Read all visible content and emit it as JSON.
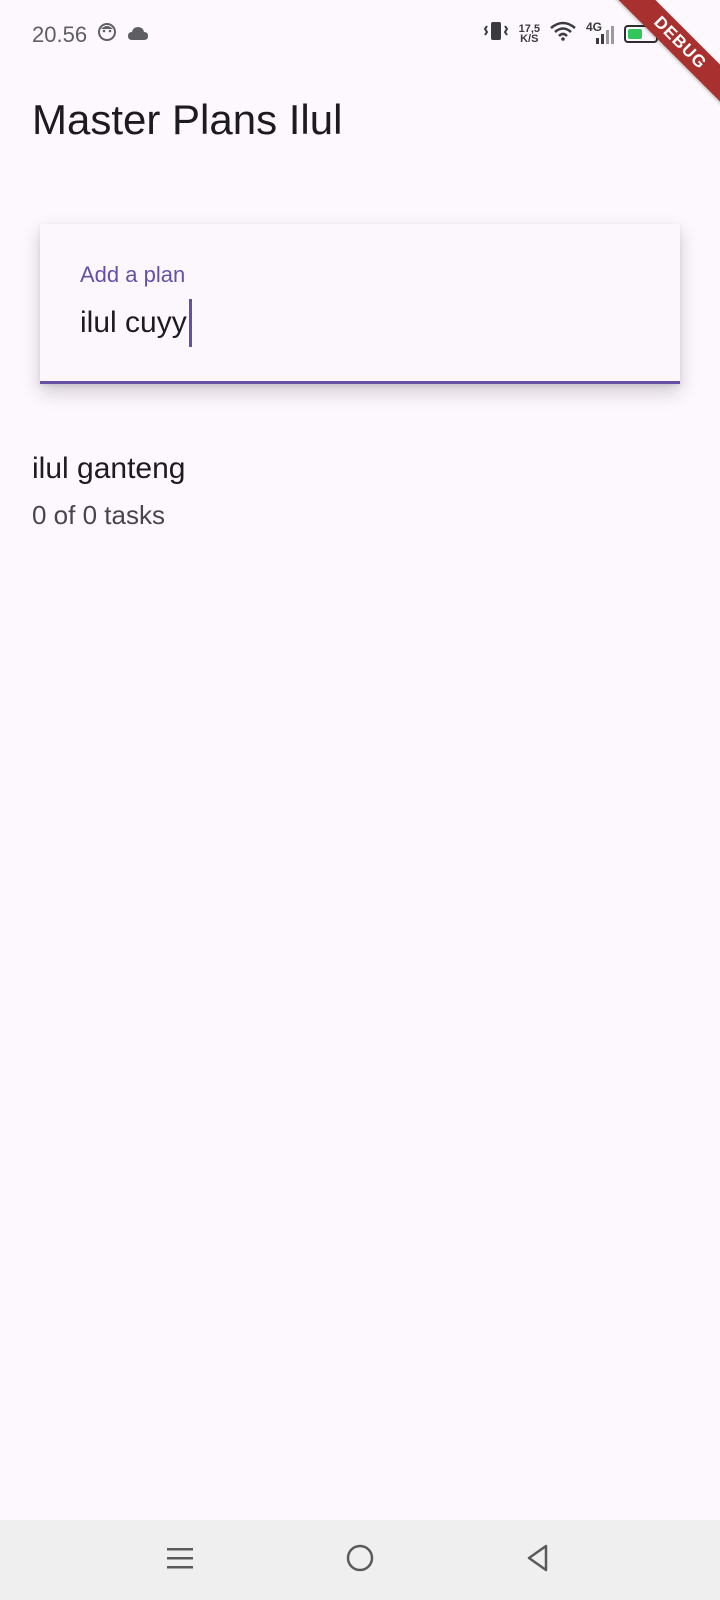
{
  "status_bar": {
    "time": "20.56",
    "net_speed_value": "17,5",
    "net_speed_unit": "K/S",
    "network_type": "4G",
    "battery_level": "60%",
    "icons": [
      "face-icon",
      "cloud-icon",
      "vibrate-icon",
      "wifi-icon",
      "signal-icon",
      "battery-icon",
      "charging-icon"
    ]
  },
  "debug_banner": "DEBUG",
  "app_bar": {
    "title": "Master Plans Ilul"
  },
  "plan_input": {
    "label": "Add a plan",
    "value": "ilul cuyy"
  },
  "plans": [
    {
      "name": "ilul ganteng",
      "progress": "0 of 0 tasks"
    }
  ],
  "nav_bar": {
    "icons": [
      "menu-icon",
      "home-icon",
      "back-icon"
    ]
  },
  "colors": {
    "accent": "#6750a4",
    "background": "#fdf7fe",
    "text": "#1d1b20",
    "debug_ribbon": "#a8312f"
  }
}
